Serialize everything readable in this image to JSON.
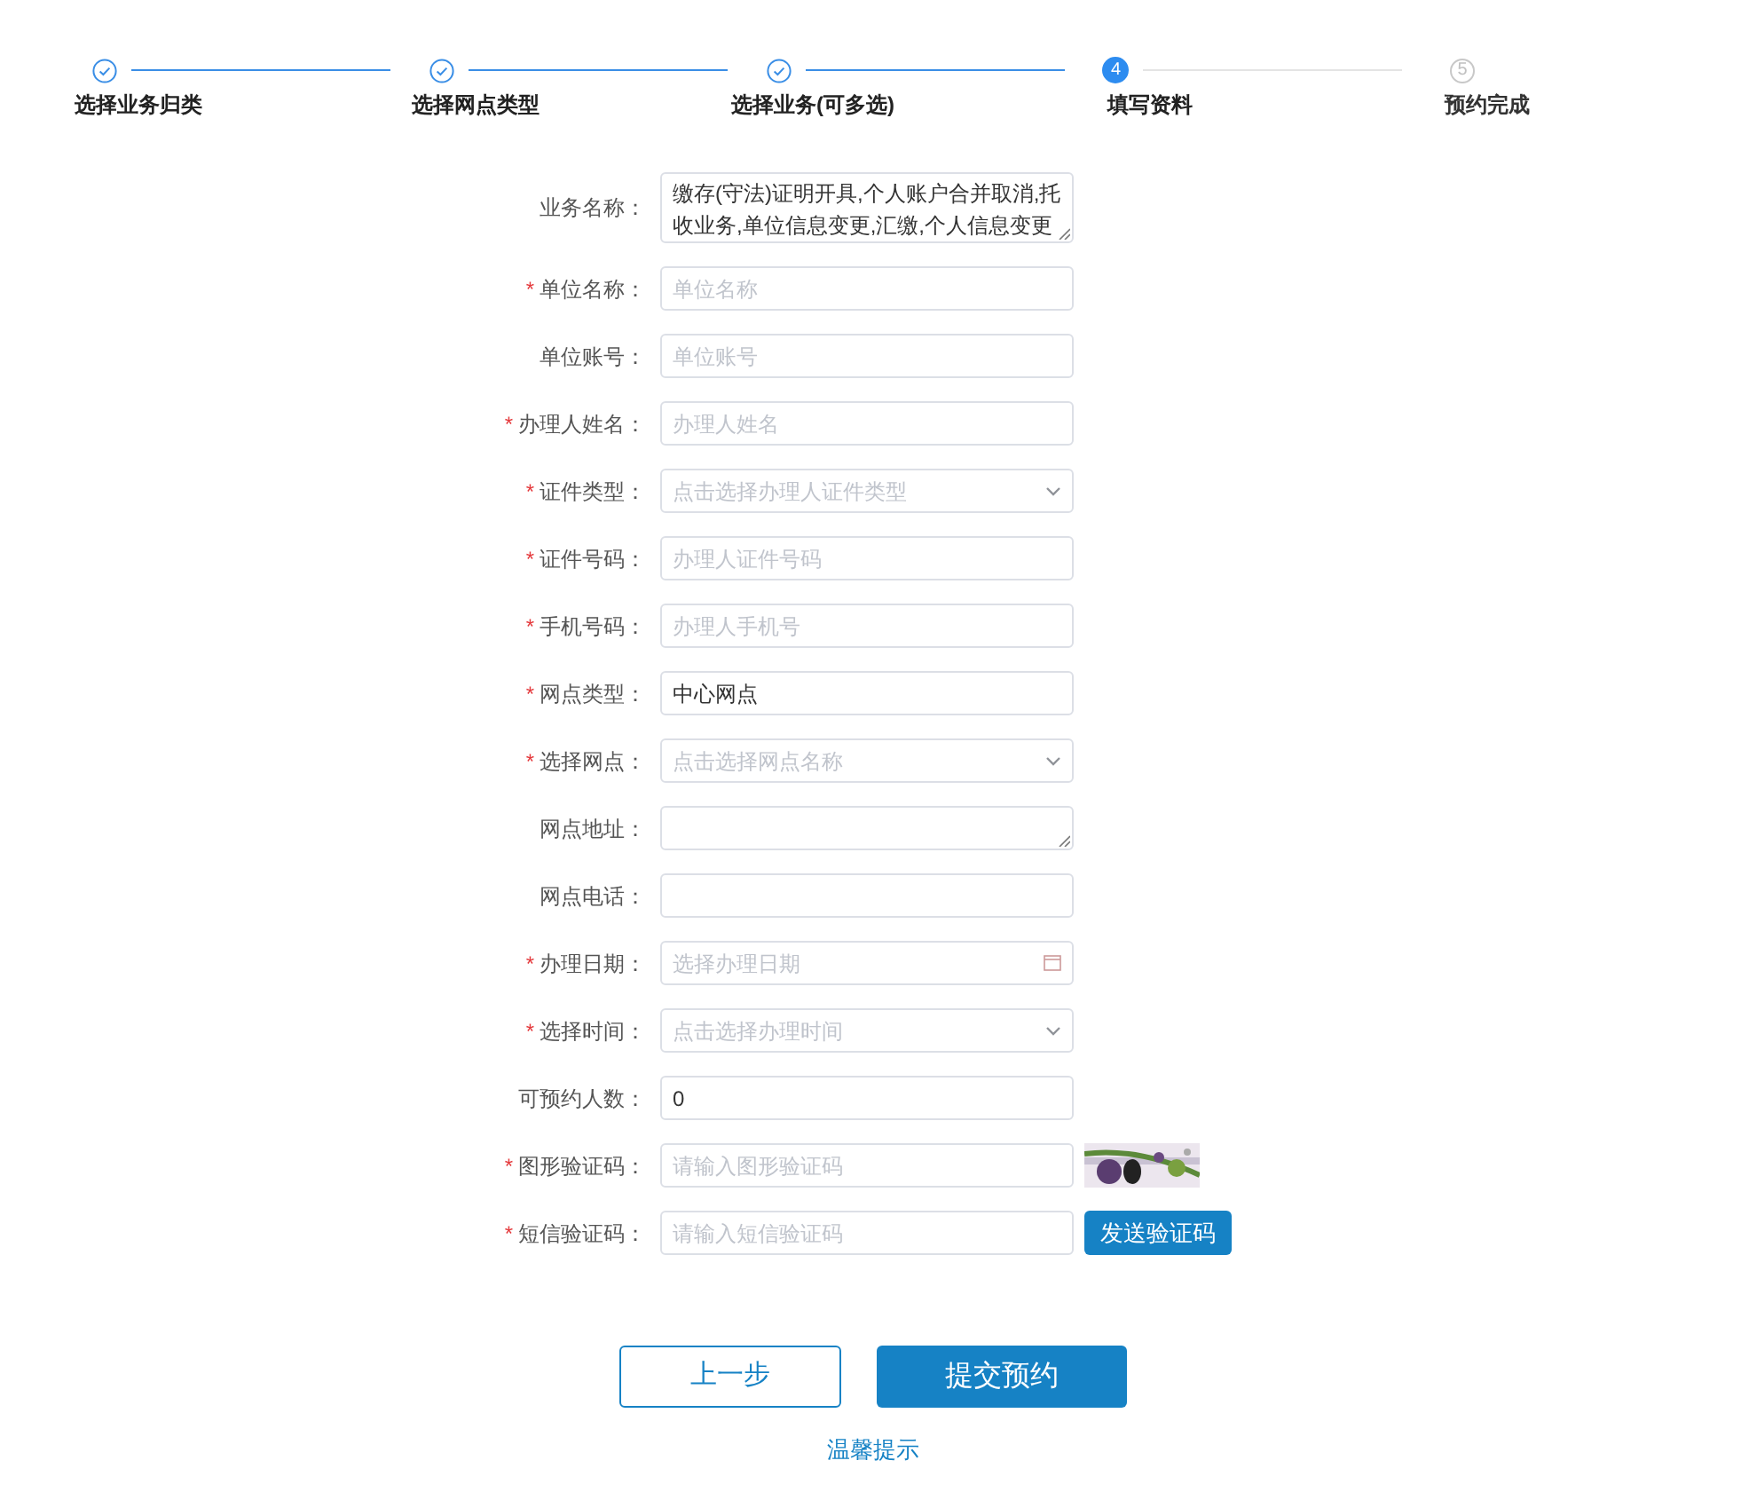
{
  "steps": [
    {
      "label": "选择业务归类",
      "done": true,
      "selected": false
    },
    {
      "label": "选择网点类型",
      "done": true,
      "selected": false
    },
    {
      "label": "选择业务(可多选)",
      "done": true,
      "selected": false
    },
    {
      "label": "填写资料",
      "number": "4",
      "done": false,
      "selected": true
    },
    {
      "label": "预约完成",
      "number": "5",
      "done": false,
      "selected": false
    }
  ],
  "form": [
    {
      "label": "业务名称：",
      "kind": "textarea",
      "value": "缴存(守法)证明开具,个人账户合并取消,托收业务,单位信息变更,汇缴,个人信息变更"
    },
    {
      "label": "单位名称：",
      "required_mark": "*",
      "kind": "input",
      "placeholder": "单位名称"
    },
    {
      "label": "单位账号：",
      "kind": "input",
      "placeholder": "单位账号"
    },
    {
      "label": "办理人姓名：",
      "required_mark": "*",
      "kind": "input",
      "placeholder": "办理人姓名"
    },
    {
      "label": "证件类型：",
      "required_mark": "*",
      "kind": "select",
      "placeholder": "点击选择办理人证件类型"
    },
    {
      "label": "证件号码：",
      "required_mark": "*",
      "kind": "input",
      "placeholder": "办理人证件号码"
    },
    {
      "label": "手机号码：",
      "required_mark": "*",
      "kind": "input",
      "placeholder": "办理人手机号"
    },
    {
      "label": "网点类型：",
      "required_mark": "*",
      "kind": "input",
      "value": "中心网点"
    },
    {
      "label": "选择网点：",
      "required_mark": "*",
      "kind": "select",
      "placeholder": "点击选择网点名称"
    },
    {
      "label": "网点地址：",
      "kind": "textarea-small"
    },
    {
      "label": "网点电话：",
      "kind": "input"
    },
    {
      "label": "办理日期：",
      "required_mark": "*",
      "kind": "date",
      "placeholder": "选择办理日期"
    },
    {
      "label": "选择时间：",
      "required_mark": "*",
      "kind": "select",
      "placeholder": "点击选择办理时间"
    },
    {
      "label": "可预约人数：",
      "kind": "input",
      "value": "0"
    },
    {
      "label": "图形验证码：",
      "required_mark": "*",
      "kind": "captcha",
      "placeholder": "请输入图形验证码"
    },
    {
      "label": "短信验证码：",
      "required_mark": "*",
      "kind": "sms",
      "placeholder": "请输入短信验证码",
      "button": "发送验证码"
    }
  ],
  "buttons": {
    "previous": "上一步",
    "submit": "提交预约"
  },
  "tips_link": "温馨提示"
}
